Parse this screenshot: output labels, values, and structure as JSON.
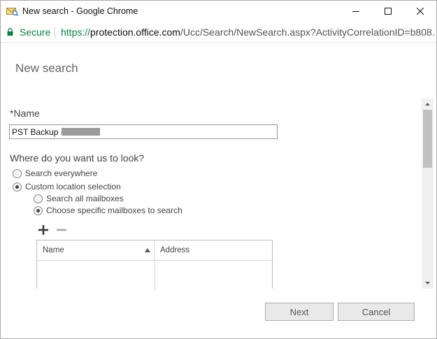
{
  "window": {
    "title": "New search - Google Chrome"
  },
  "addressbar": {
    "secure_label": "Secure",
    "url_scheme": "https://",
    "url_host": "protection.office.com",
    "url_path": "/Ucc/Search/NewSearch.aspx?ActivityCorrelationID=b808…"
  },
  "panel": {
    "title": "New search"
  },
  "form": {
    "name_label": "*Name",
    "name_value": "PST Backup - ",
    "location_question": "Where do you want us to look?",
    "location_options": [
      {
        "label": "Search everywhere",
        "checked": false
      },
      {
        "label": "Custom location selection",
        "checked": true
      }
    ],
    "mailbox_options": [
      {
        "label": "Search all mailboxes",
        "checked": false
      },
      {
        "label": "Choose specific mailboxes to search",
        "checked": true
      }
    ]
  },
  "mailbox_table": {
    "columns": [
      "Name",
      "Address"
    ],
    "sort_column": "Name",
    "sort_direction": "ascending",
    "rows": []
  },
  "footer": {
    "next_label": "Next",
    "cancel_label": "Cancel"
  },
  "colors": {
    "secure_green": "#0b8043",
    "button_bg": "#e9e9e9"
  },
  "icons": {
    "title": "envelope-search-icon",
    "lock": "lock-icon",
    "add": "plus-icon",
    "remove": "minus-icon",
    "sort": "sort-ascending-icon"
  }
}
